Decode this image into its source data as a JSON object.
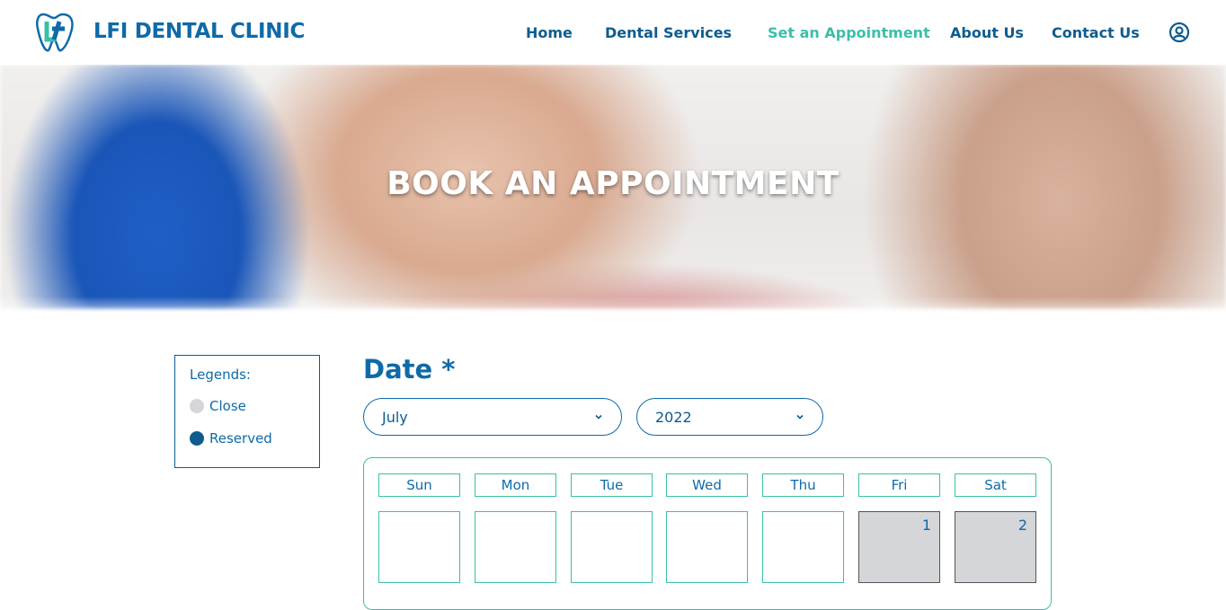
{
  "brand": {
    "name": "LFI DENTAL CLINIC"
  },
  "nav": {
    "home": "Home",
    "services": "Dental Services",
    "appointment": "Set an Appointment",
    "about": "About Us",
    "contact": "Contact Us"
  },
  "hero": {
    "title": "BOOK AN APPOINTMENT"
  },
  "legends": {
    "title": "Legends:",
    "items": [
      {
        "label": "Close",
        "color": "#d4d6d9"
      },
      {
        "label": "Reserved",
        "color": "#0e5c8f"
      }
    ]
  },
  "date": {
    "label": "Date *",
    "month": "July",
    "year": "2022"
  },
  "calendar": {
    "weekdays": [
      "Sun",
      "Mon",
      "Tue",
      "Wed",
      "Thu",
      "Fri",
      "Sat"
    ],
    "first_week": [
      "",
      "",
      "",
      "",
      "",
      "1",
      "2"
    ],
    "closed_days": [
      "1",
      "2"
    ]
  },
  "colors": {
    "primary": "#0e6aa8",
    "accent": "#3bbfa7",
    "closed": "#d4d6d9",
    "reserved": "#0e5c8f"
  }
}
